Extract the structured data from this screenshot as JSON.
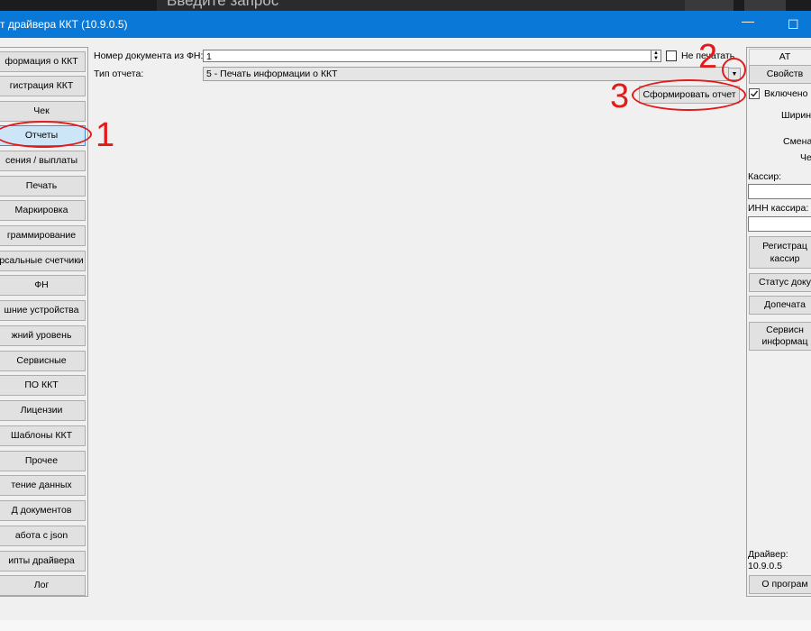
{
  "taskbar": {
    "search_placeholder": "Введите запрос"
  },
  "window": {
    "title": "т драйвера ККТ (10.9.0.5)",
    "maximize_glyph": "☐"
  },
  "nav": [
    {
      "label": "формация о ККТ"
    },
    {
      "label": "гистрация ККТ"
    },
    {
      "label": "Чек"
    },
    {
      "label": "Отчеты"
    },
    {
      "label": "сения / выплаты"
    },
    {
      "label": "Печать"
    },
    {
      "label": "Маркировка"
    },
    {
      "label": "граммирование"
    },
    {
      "label": "рсальные счетчики"
    },
    {
      "label": "ФН"
    },
    {
      "label": "шние устройства"
    },
    {
      "label": "жний уровень"
    },
    {
      "label": "Сервисные"
    },
    {
      "label": "ПО ККТ"
    },
    {
      "label": "Лицензии"
    },
    {
      "label": "Шаблоны ККТ"
    },
    {
      "label": "Прочее"
    },
    {
      "label": "тение данных"
    },
    {
      "label": "Д документов"
    },
    {
      "label": "абота с json"
    },
    {
      "label": "ипты драйвера"
    },
    {
      "label": "Лог"
    }
  ],
  "form": {
    "doc_number_label": "Номер документа из ФН:",
    "doc_number_value": "1",
    "no_print_label": "Не печатать",
    "report_type_label": "Тип отчета:",
    "report_type_value": "5 - Печать информации о ККТ",
    "generate_button": "Сформировать отчет"
  },
  "annotations": {
    "n1": "1",
    "n2": "2",
    "n3": "3"
  },
  "right_panel": {
    "top_label": "АТ",
    "properties_button": "Свойств",
    "enabled_label": "Включено",
    "width_label": "Ширин",
    "shift_label": "Смена",
    "check_label": "Че",
    "cashier_label": "Кассир:",
    "inn_label": "ИНН кассира:",
    "register_button_line1": "Регистрац",
    "register_button_line2": "кассир",
    "doc_status_button": "Статус доку",
    "reprint_button": "Допечата",
    "service_info_line1": "Сервисн",
    "service_info_line2": "информац",
    "driver_label": "Драйвер:",
    "driver_version": "10.9.0.5",
    "about_button": "О програм"
  },
  "colors": {
    "titlebar": "#0a78d7",
    "annotation": "#e21a1a",
    "active_nav": "#cde6f7"
  }
}
